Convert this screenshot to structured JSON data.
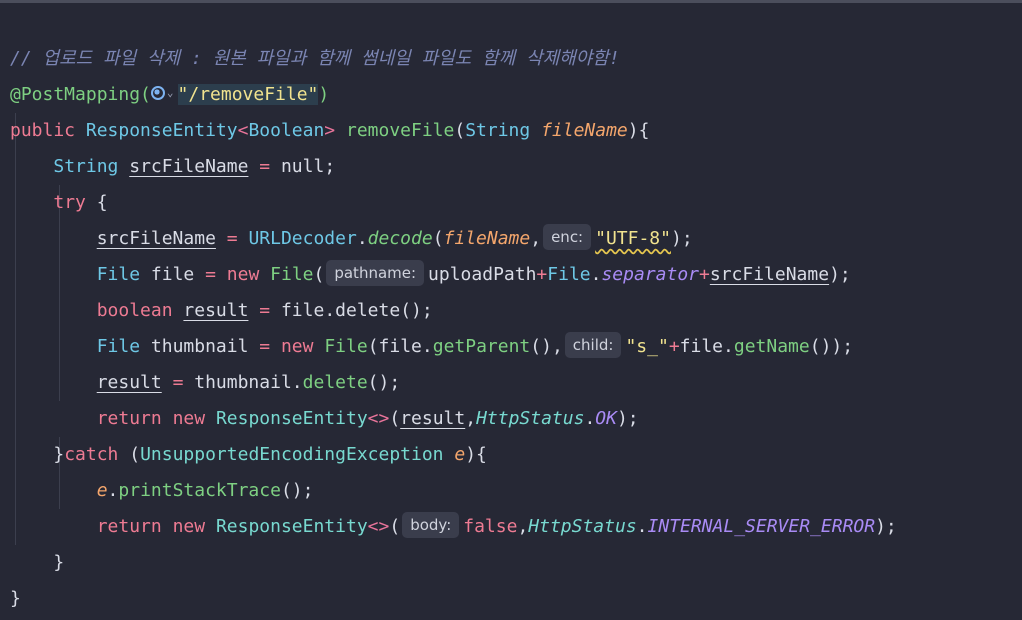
{
  "colors": {
    "background": "#262835",
    "comment": "#7b85b3",
    "keyword": "#ee7b93",
    "type": "#6ec8e6",
    "method": "#7ed082",
    "parameter": "#f4a66c",
    "string": "#f1e38f",
    "static_field": "#a98bf5",
    "inlay_hint_bg": "#3a3d4c"
  },
  "icons": {
    "endpoint": "globe-icon",
    "dropdown": "chevron-down-icon"
  },
  "code": {
    "comment": "// 업로드 파일 삭제 : 원본 파일과 함께 썸네일 파일도 함께 삭제해야함!",
    "annotation": "@PostMapping(",
    "mapping_path": "\"/removeFile\"",
    "close_paren": ")",
    "kw_public": "public",
    "type_response_entity": "ResponseEntity",
    "generic_open": "<",
    "type_boolean": "Boolean",
    "generic_close": ">",
    "method_remove_file": "removeFile",
    "type_string": "String",
    "param_file_name": "fileName",
    "open_brace": "){",
    "var_src_file_name": "srcFileName",
    "assign": " = ",
    "null_value": "null;",
    "kw_try": "try",
    "brace_open": "{",
    "url_decoder": "URLDecoder",
    "decode_fn": "decode",
    "hint_enc": "enc:",
    "utf8": "\"UTF-8\"",
    "end_stmt": ");",
    "type_file": "File",
    "var_file": "file",
    "kw_new": "new",
    "hint_pathname": "pathname:",
    "upload_path": "uploadPath",
    "plus": "+",
    "separator": "separator",
    "kw_boolean": "boolean",
    "var_result": "result",
    "delete_call": "delete",
    "var_thumbnail": "thumbnail",
    "get_parent": "getParent",
    "hint_child": "child:",
    "str_s": "\"s_\"",
    "get_name": "getName",
    "kw_return": "return",
    "diamond": "<>",
    "http_status": "HttpStatus",
    "ok": "OK",
    "kw_catch": "catch",
    "exception_type": "UnsupportedEncodingException",
    "param_e": "e",
    "print_stack_trace": "printStackTrace",
    "hint_body": "body:",
    "kw_false": "false",
    "internal_error": "INTERNAL_SERVER_ERROR",
    "brace_close": "}"
  }
}
